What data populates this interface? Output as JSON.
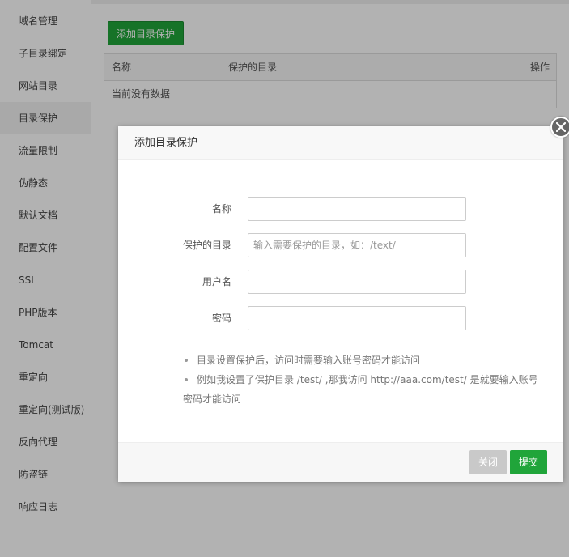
{
  "sidebar": {
    "items": [
      {
        "label": "域名管理"
      },
      {
        "label": "子目录绑定"
      },
      {
        "label": "网站目录"
      },
      {
        "label": "目录保护"
      },
      {
        "label": "流量限制"
      },
      {
        "label": "伪静态"
      },
      {
        "label": "默认文档"
      },
      {
        "label": "配置文件"
      },
      {
        "label": "SSL"
      },
      {
        "label": "PHP版本"
      },
      {
        "label": "Tomcat"
      },
      {
        "label": "重定向"
      },
      {
        "label": "重定向(测试版)"
      },
      {
        "label": "反向代理"
      },
      {
        "label": "防盗链"
      },
      {
        "label": "响应日志"
      }
    ],
    "active_index": 3
  },
  "main": {
    "add_button": "添加目录保护",
    "table": {
      "columns": [
        "名称",
        "保护的目录",
        "操作"
      ],
      "empty_text": "当前没有数据"
    }
  },
  "modal": {
    "title": "添加目录保护",
    "fields": [
      {
        "label": "名称",
        "value": "",
        "placeholder": ""
      },
      {
        "label": "保护的目录",
        "value": "",
        "placeholder": "输入需要保护的目录，如：/text/"
      },
      {
        "label": "用户名",
        "value": "",
        "placeholder": ""
      },
      {
        "label": "密码",
        "value": "",
        "placeholder": ""
      }
    ],
    "tips": [
      "目录设置保护后，访问时需要输入账号密码才能访问",
      "例如我设置了保护目录 /test/ ,那我访问 http://aaa.com/test/ 是就要输入账号密码才能访问"
    ],
    "buttons": {
      "close": "关闭",
      "submit": "提交"
    }
  },
  "colors": {
    "accent": "#20a53a",
    "close_button": "#c9c9c9",
    "overlay": "rgba(0,0,0,0.3)"
  },
  "icons": {
    "modal_close": "close-icon"
  }
}
